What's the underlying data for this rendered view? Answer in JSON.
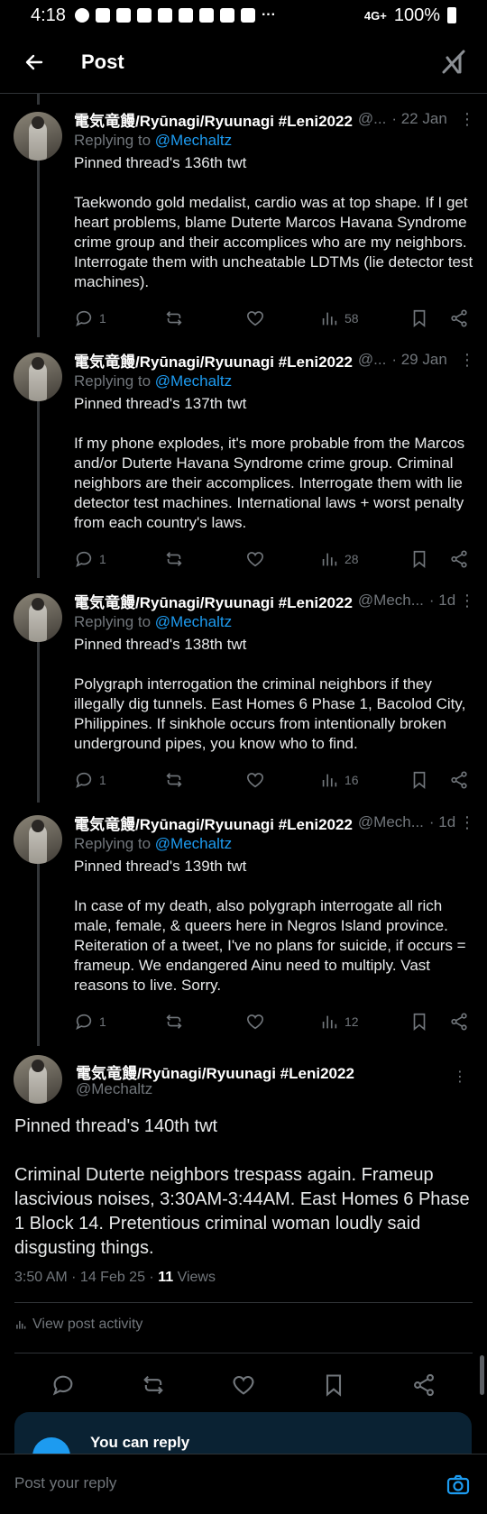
{
  "status": {
    "time": "4:18",
    "battery": "100%",
    "network": "4G+"
  },
  "header": {
    "title": "Post"
  },
  "author": {
    "name": "電気竜饅/Ryūnagi/Ryuunagi #Leni2022",
    "handle": "@Mechaltz"
  },
  "thread": [
    {
      "handle_trunc": "@...",
      "date": "· 22 Jan",
      "replying_prefix": "Replying to ",
      "replying_to": "@Mechaltz",
      "text": "Pinned thread's 136th twt\n\nTaekwondo gold medalist, cardio was at top shape. If I get heart problems, blame Duterte Marcos Havana Syndrome crime group and their accomplices who are my neighbors. Interrogate them with uncheatable LDTMs (lie detector test machines).",
      "replies": "1",
      "views": "58"
    },
    {
      "handle_trunc": "@...",
      "date": "· 29 Jan",
      "replying_prefix": "Replying to ",
      "replying_to": "@Mechaltz",
      "text": "Pinned thread's 137th twt\n\nIf my phone explodes, it's more probable from the Marcos and/or Duterte Havana Syndrome crime group. Criminal neighbors are their accomplices. Interrogate them with lie detector test machines. International laws + worst penalty from each country's laws.",
      "replies": "1",
      "views": "28"
    },
    {
      "handle_trunc": "@Mech...",
      "date": "· 1d",
      "replying_prefix": "Replying to ",
      "replying_to": "@Mechaltz",
      "text": "Pinned thread's 138th twt\n\nPolygraph interrogation the criminal neighbors if they illegally dig tunnels. East Homes 6 Phase 1, Bacolod City, Philippines. If sinkhole occurs from intentionally broken underground pipes, you know who to find.",
      "replies": "1",
      "views": "16"
    },
    {
      "handle_trunc": "@Mech...",
      "date": "· 1d",
      "replying_prefix": "Replying to ",
      "replying_to": "@Mechaltz",
      "text": "Pinned thread's 139th twt\n\nIn case of my death, also polygraph interrogate all rich male, female, & queers here in Negros Island province. Reiteration of a tweet, I've no plans for suicide, if occurs = frameup. We endangered Ainu need to multiply. Vast reasons to live. Sorry.",
      "replies": "1",
      "views": "12"
    }
  ],
  "main_post": {
    "text": "Pinned thread's 140th twt\n\nCriminal Duterte neighbors trespass again. Frameup lascivious noises, 3:30AM-3:44AM. East Homes 6 Phase 1 Block 14. Pretentious criminal woman loudly said disgusting things.",
    "meta_prefix": "3:50 AM · 14 Feb 25 · ",
    "views_count": "11",
    "views_label": " Views",
    "activity": "View post activity"
  },
  "reply_card": {
    "title": "You can reply"
  },
  "composer": {
    "placeholder": "Post your reply"
  },
  "colors": {
    "accent": "#1d9bf0",
    "muted": "#71767b",
    "background": "#000000"
  }
}
